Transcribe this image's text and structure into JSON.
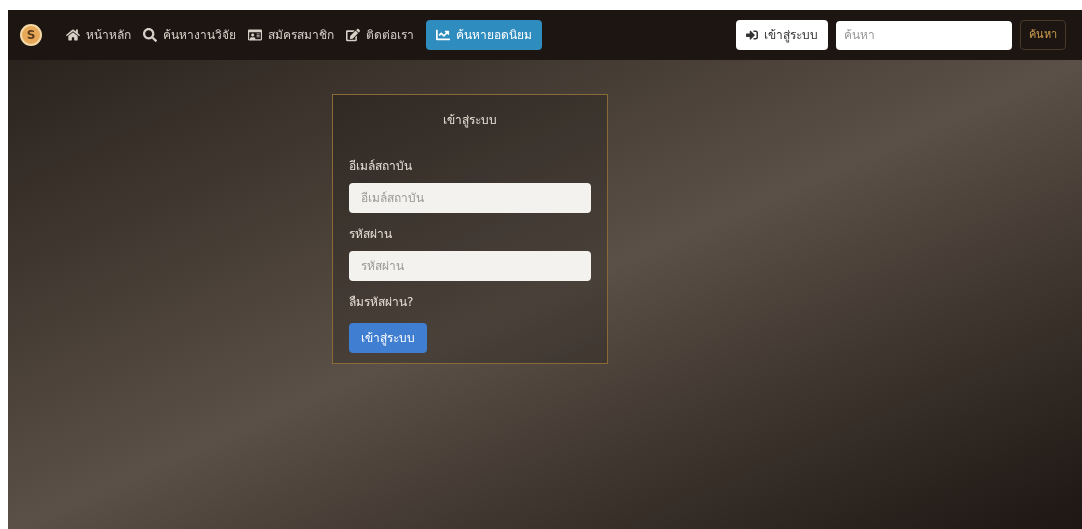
{
  "navbar": {
    "logo_letter": "S",
    "items": [
      {
        "label": "หน้าหลัก",
        "kind": "home",
        "selected": false
      },
      {
        "label": "ค้นหางานวิจัย",
        "kind": "search",
        "selected": false
      },
      {
        "label": "สมัครสมาชิก",
        "kind": "card",
        "selected": false
      },
      {
        "label": "ติดต่อเรา",
        "kind": "edit",
        "selected": false
      },
      {
        "label": "ค้นหายอดนิยม",
        "kind": "chart",
        "selected": true
      }
    ],
    "login_button": "เข้าสู่ระบบ",
    "search": {
      "placeholder": "ค้นหา"
    },
    "search_button": "ค้นหา"
  },
  "login_form": {
    "title": "เข้าสู่ระบบ",
    "fields": [
      {
        "label": "อีเมล์สถาบัน",
        "placeholder": "อีเมล์สถาบัน"
      },
      {
        "label": "รหัสผ่าน",
        "placeholder": "รหัสผ่าน"
      }
    ],
    "forgot_link": "ลืมรหัสผ่าน?",
    "submit": "เข้าสู่ระบบ"
  }
}
